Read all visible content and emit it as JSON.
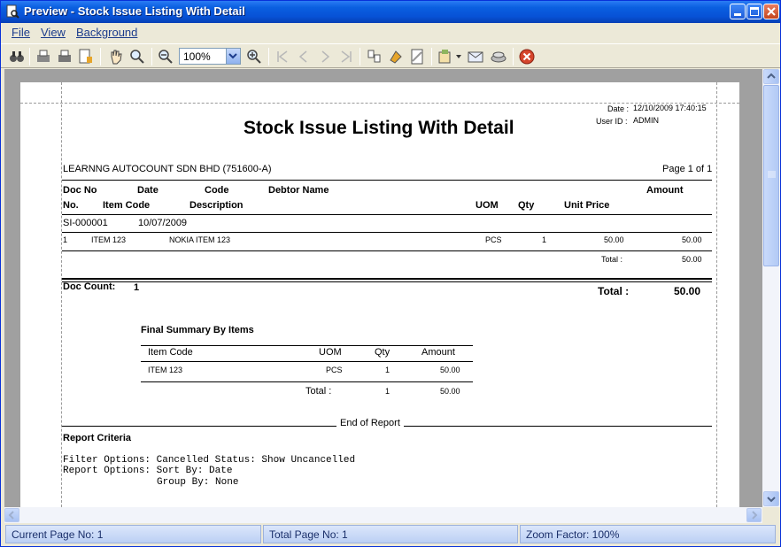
{
  "window": {
    "title": "Preview - Stock Issue Listing With Detail"
  },
  "menu": {
    "file": "File",
    "view": "View",
    "background": "Background"
  },
  "toolbar": {
    "zoom_value": "100%"
  },
  "report": {
    "date_label": "Date :",
    "date_value": "12/10/2009 17:40:15",
    "user_label": "User ID :",
    "user_value": "ADMIN",
    "title": "Stock Issue Listing With Detail",
    "company": "LEARNNG AUTOCOUNT SDN BHD (751600-A)",
    "page_info": "Page 1 of 1",
    "headers_row1": {
      "doc_no": "Doc No",
      "date": "Date",
      "code": "Code",
      "debtor_name": "Debtor Name",
      "amount": "Amount"
    },
    "headers_row2": {
      "no": "No.",
      "item_code": "Item Code",
      "description": "Description",
      "uom": "UOM",
      "qty": "Qty",
      "unit_price": "Unit Price"
    },
    "doc": {
      "doc_no": "SI-000001",
      "date": "10/07/2009"
    },
    "detail": {
      "no": "1",
      "item_code": "ITEM 123",
      "description": "NOKIA ITEM 123",
      "uom": "PCS",
      "qty": "1",
      "unit_price": "50.00",
      "amount": "50.00"
    },
    "doc_total_label": "Total :",
    "doc_total_value": "50.00",
    "doc_count_label": "Doc Count:",
    "doc_count_value": "1",
    "grand_total_label": "Total :",
    "grand_total_value": "50.00",
    "summary": {
      "title": "Final Summary By Items",
      "headers": {
        "item_code": "Item Code",
        "uom": "UOM",
        "qty": "Qty",
        "amount": "Amount"
      },
      "row": {
        "item_code": "ITEM 123",
        "uom": "PCS",
        "qty": "1",
        "amount": "50.00"
      },
      "total_label": "Total :",
      "total_qty": "1",
      "total_amount": "50.00"
    },
    "end_of_report": "End of Report",
    "criteria": {
      "title": "Report Criteria",
      "line1": "Filter Options: Cancelled Status: Show Uncancelled",
      "line2": "Report Options: Sort By: Date",
      "line3": "Group By: None"
    }
  },
  "status": {
    "current_page": "Current Page No: 1",
    "total_page": "Total Page No: 1",
    "zoom_factor": "Zoom Factor: 100%"
  }
}
